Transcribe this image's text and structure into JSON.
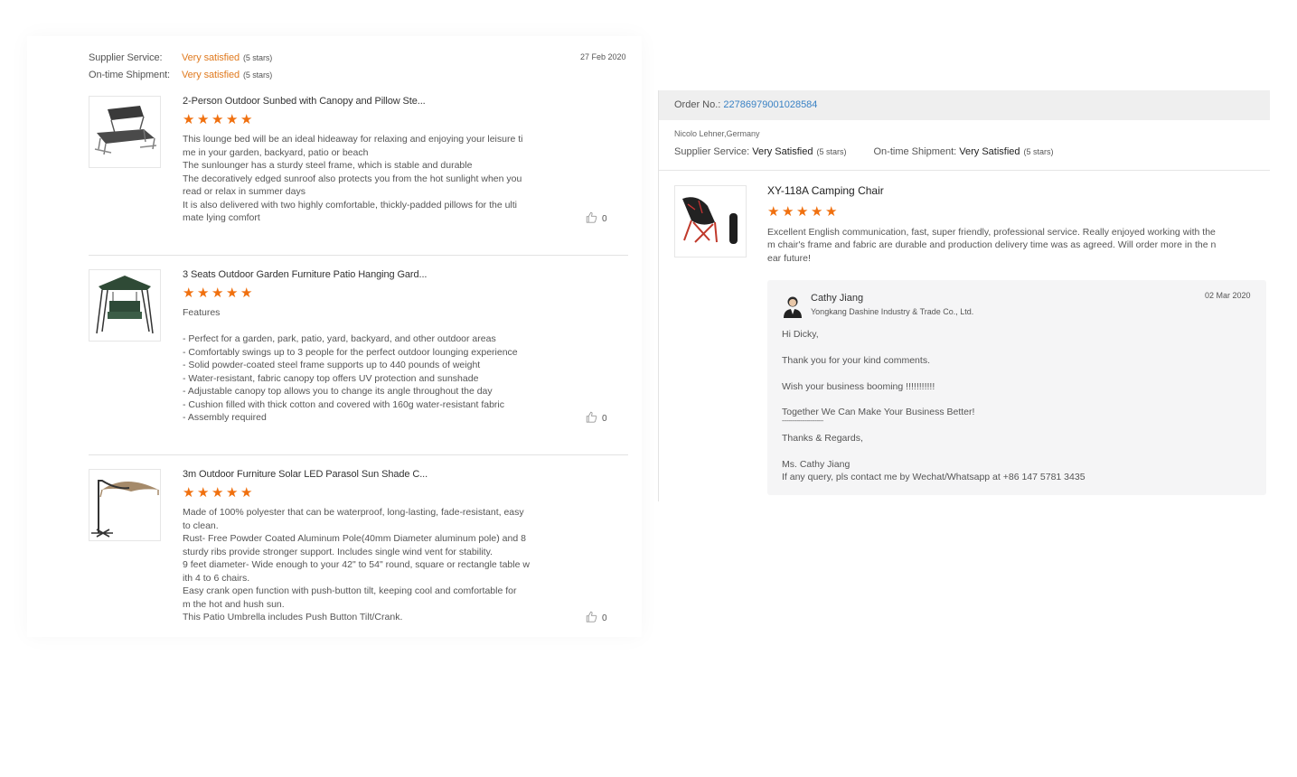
{
  "summary": {
    "supplier_service_label": "Supplier Service:",
    "supplier_service_value": "Very satisfied",
    "supplier_service_stars": "(5 stars)",
    "shipment_label": "On-time Shipment:",
    "shipment_value": "Very satisfied",
    "shipment_stars": "(5 stars)",
    "date": "27 Feb 2020"
  },
  "reviews": [
    {
      "title": "2-Person Outdoor Sunbed with Canopy and Pillow Ste...",
      "rating": 5,
      "image_icon": "sunbed-icon",
      "lines": [
        "This lounge bed will be an ideal hideaway for relaxing and enjoying your leisure ti",
        "me in your garden, backyard, patio or beach",
        "The sunlounger has a sturdy steel frame, which is stable and durable",
        "The decoratively edged sunroof also protects you from the hot sunlight when you",
        "read or relax in summer days",
        "It is also delivered with two highly comfortable, thickly-padded pillows for the ulti",
        "mate lying comfort"
      ],
      "likes": "0"
    },
    {
      "title": "3 Seats Outdoor Garden Furniture Patio Hanging Gard...",
      "rating": 5,
      "image_icon": "swing-chair-icon",
      "lines": [
        "Features",
        "",
        "- Perfect for a garden, park, patio, yard, backyard, and other outdoor areas",
        "- Comfortably swings up to 3 people for the perfect outdoor lounging experience",
        "- Solid powder-coated steel frame supports up to 440 pounds of weight",
        "- Water-resistant, fabric canopy top offers UV protection and sunshade",
        "- Adjustable canopy top allows you to change its angle throughout the day",
        "- Cushion filled with thick cotton and covered with 160g water-resistant fabric",
        "- Assembly required"
      ],
      "likes": "0"
    },
    {
      "title": "3m Outdoor Furniture Solar LED Parasol Sun Shade C...",
      "rating": 5,
      "image_icon": "parasol-icon",
      "lines": [
        "Made of 100% polyester that can be waterproof, long-lasting, fade-resistant, easy",
        "to clean.",
        "Rust- Free Powder Coated Aluminum Pole(40mm Diameter aluminum pole) and 8",
        "sturdy ribs provide stronger support. Includes single wind vent for stability.",
        "9 feet diameter- Wide enough to your 42\" to 54\" round, square or rectangle table w",
        "ith 4 to 6 chairs.",
        "Easy crank open function with push-button tilt, keeping cool and comfortable for",
        "m the hot and hush sun.",
        "This Patio Umbrella includes Push Button Tilt/Crank."
      ],
      "likes": "0"
    }
  ],
  "order": {
    "label": "Order No.:",
    "number": "22786979001028584",
    "reviewer": "Nicolo Lehner,Germany",
    "supplier_service_label": "Supplier Service:",
    "supplier_service_value": "Very Satisfied",
    "supplier_service_stars": "(5 stars)",
    "shipment_label": "On-time Shipment:",
    "shipment_value": "Very Satisfied",
    "shipment_stars": "(5 stars)",
    "product_title": "XY-118A Camping Chair",
    "rating": 5,
    "image_icon": "camping-chair-icon",
    "lines": [
      "Excellent English communication, fast, super friendly, professional service. Really enjoyed working with the",
      "m  chair's frame and fabric are durable and production delivery time was as agreed. Will order more in the n",
      "ear future!"
    ],
    "reply": {
      "name": "Cathy Jiang",
      "company": "Yongkang Dashine Industry & Trade Co., Ltd.",
      "date": "02 Mar 2020",
      "lines": [
        "Hi  Dicky,",
        "Thank you for your kind comments.",
        "Wish your business booming !!!!!!!!!!!",
        "Together We Can Make Your Business Better!",
        "-------------------------",
        "Thanks & Regards,",
        "Ms.  Cathy Jiang",
        "If any query, pls contact me by Wechat/Whatsapp at +86 147 5781 3435"
      ]
    }
  },
  "colors": {
    "star": "#f0700f",
    "satisfied": "#e07a1f",
    "order_link": "#3a82c4"
  }
}
